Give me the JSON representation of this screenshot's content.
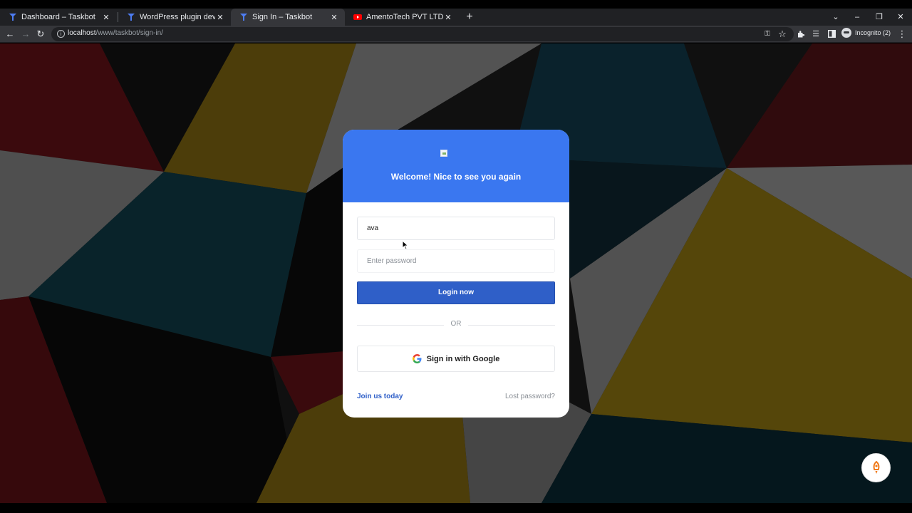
{
  "browser": {
    "tabs": [
      {
        "title": "Dashboard – Taskbot",
        "icon": "taskbot-favicon",
        "active": false
      },
      {
        "title": "WordPress plugin developmet fo",
        "icon": "taskbot-favicon",
        "active": false
      },
      {
        "title": "Sign In – Taskbot",
        "icon": "taskbot-favicon",
        "active": true
      },
      {
        "title": "AmentoTech PVT LTD - YouTube",
        "icon": "youtube-favicon",
        "active": false
      }
    ],
    "close_glyph": "✕",
    "new_tab_glyph": "+",
    "address": {
      "host": "localhost",
      "path": "/www/taskbot/sign-in/"
    },
    "incognito_label": "Incognito (2)"
  },
  "login": {
    "heading": "Welcome! Nice to see you again",
    "username_value": "ava",
    "password_placeholder": "Enter password",
    "login_button": "Login now",
    "or_separator": "OR",
    "google_button": "Sign in with Google",
    "join_link": "Join us today",
    "lost_password_link": "Lost password?"
  },
  "colors": {
    "header_blue": "#3a77f0",
    "button_blue": "#2f5fc8",
    "chrome_dark": "#202124",
    "chrome_toolbar": "#35363a"
  }
}
